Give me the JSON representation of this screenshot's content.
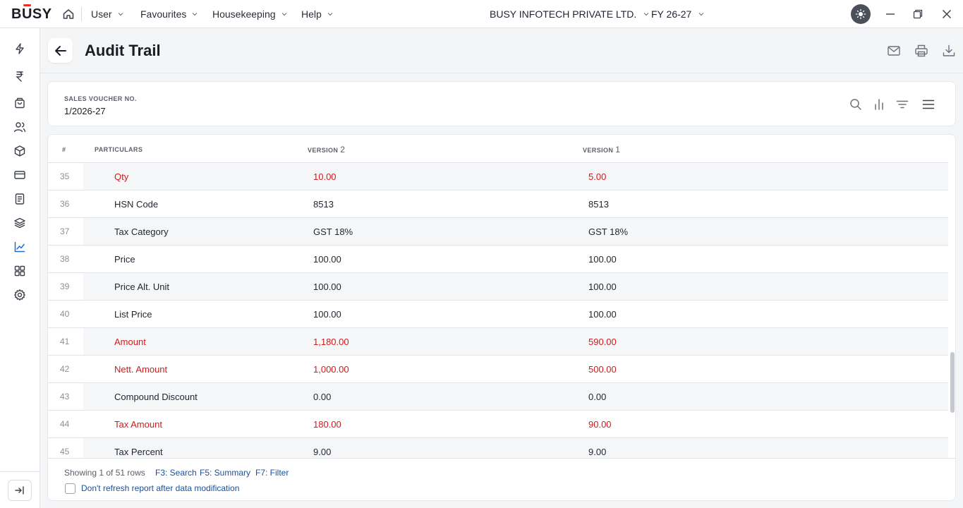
{
  "app": {
    "logo": "BUSY",
    "menus": [
      {
        "label": "User"
      },
      {
        "label": "Favourites"
      },
      {
        "label": "Housekeeping"
      },
      {
        "label": "Help"
      }
    ],
    "company": "BUSY INFOTECH PRIVATE LTD.",
    "fy": "FY 26-27"
  },
  "sidebar": {
    "items": [
      {
        "icon": "lightning-icon"
      },
      {
        "icon": "rupee-icon"
      },
      {
        "icon": "shopping-bag-icon"
      },
      {
        "icon": "users-icon"
      },
      {
        "icon": "package-icon"
      },
      {
        "icon": "card-icon"
      },
      {
        "icon": "document-icon"
      },
      {
        "icon": "layers-icon"
      },
      {
        "icon": "chart-line-icon",
        "active": true
      },
      {
        "icon": "grid-icon"
      },
      {
        "icon": "settings-icon"
      }
    ]
  },
  "header": {
    "title": "Audit Trail",
    "actions": [
      "mail-icon",
      "print-icon",
      "download-icon"
    ]
  },
  "voucher": {
    "label": "SALES VOUCHER NO.",
    "value": "1/2026-27",
    "tools": [
      "search-icon",
      "bar-chart-icon",
      "filter-icon",
      "menu-icon"
    ]
  },
  "table": {
    "headers": {
      "num": "#",
      "particulars": "PARTICULARS",
      "version2_label": "VERSION",
      "version2_num": "2",
      "version1_label": "VERSION",
      "version1_num": "1"
    },
    "rows": [
      {
        "num": "35",
        "particular": "Qty",
        "v2": "10.00",
        "v1": "5.00",
        "changed": true
      },
      {
        "num": "36",
        "particular": "HSN Code",
        "v2": "8513",
        "v1": "8513",
        "changed": false
      },
      {
        "num": "37",
        "particular": "Tax Category",
        "v2": "GST 18%",
        "v1": "GST 18%",
        "changed": false
      },
      {
        "num": "38",
        "particular": "Price",
        "v2": "100.00",
        "v1": "100.00",
        "changed": false
      },
      {
        "num": "39",
        "particular": "Price Alt. Unit",
        "v2": "100.00",
        "v1": "100.00",
        "changed": false
      },
      {
        "num": "40",
        "particular": "List Price",
        "v2": "100.00",
        "v1": "100.00",
        "changed": false
      },
      {
        "num": "41",
        "particular": "Amount",
        "v2": "1,180.00",
        "v1": "590.00",
        "changed": true
      },
      {
        "num": "42",
        "particular": "Nett. Amount",
        "v2": "1,000.00",
        "v1": "500.00",
        "changed": true
      },
      {
        "num": "43",
        "particular": "Compound Discount",
        "v2": "0.00",
        "v1": "0.00",
        "changed": false
      },
      {
        "num": "44",
        "particular": "Tax Amount",
        "v2": "180.00",
        "v1": "90.00",
        "changed": true
      },
      {
        "num": "45",
        "particular": "Tax Percent",
        "v2": "9.00",
        "v1": "9.00",
        "changed": false
      }
    ]
  },
  "footer": {
    "showing": "Showing 1 of 51 rows",
    "shortcuts": [
      "F3: Search",
      "F5: Summary",
      "F7: Filter"
    ],
    "checkbox_label": "Don't refresh report after data modification"
  },
  "colors": {
    "changed": "#d11a1a",
    "link": "#1c4f9c",
    "active_icon": "#1f6fd1",
    "brand_accent": "#e62d2d"
  }
}
